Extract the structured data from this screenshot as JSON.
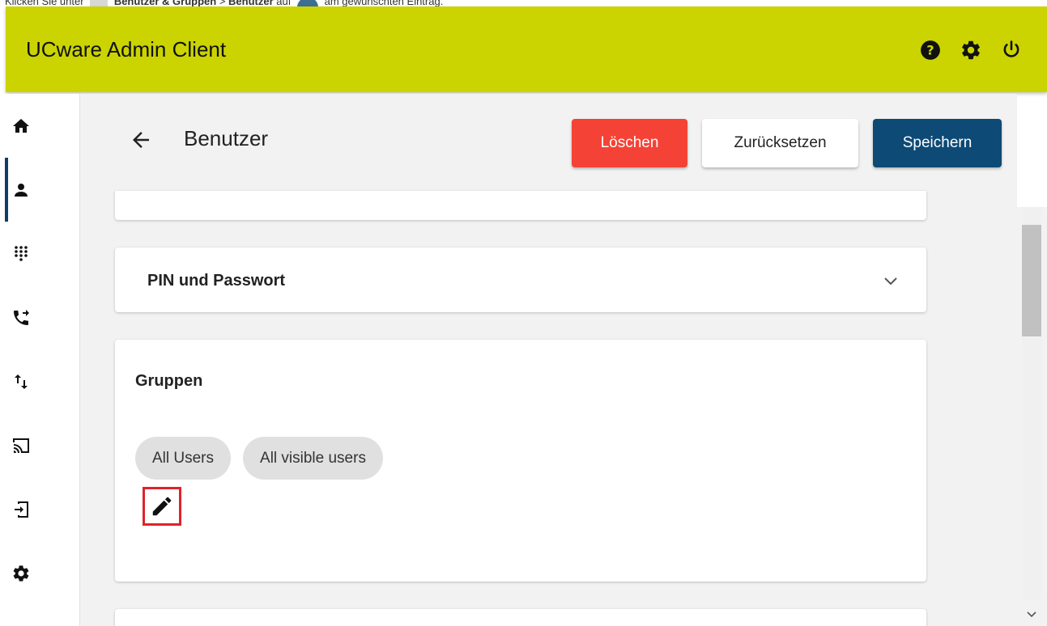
{
  "instruction": {
    "prefix": "Klicken Sie unter",
    "menu_path": "Benutzer & Gruppen",
    "separator": " > ",
    "submenu": "Benutzer",
    "middle": "auf",
    "suffix": "am gewünschten Eintrag."
  },
  "header": {
    "app_title": "UCware Admin Client",
    "icons": [
      "help-icon",
      "settings-icon",
      "power-icon"
    ]
  },
  "sidebar": {
    "items": [
      {
        "icon": "home-icon",
        "active": false
      },
      {
        "icon": "user-icon",
        "active": true
      },
      {
        "icon": "dialpad-icon",
        "active": false
      },
      {
        "icon": "call-forward-icon",
        "active": false
      },
      {
        "icon": "transfer-arrows-icon",
        "active": false
      },
      {
        "icon": "cast-icon",
        "active": false
      },
      {
        "icon": "login-icon",
        "active": false
      },
      {
        "icon": "settings-icon",
        "active": false
      }
    ]
  },
  "page": {
    "title": "Benutzer",
    "buttons": {
      "delete": "Löschen",
      "reset": "Zurücksetzen",
      "save": "Speichern"
    }
  },
  "sections": {
    "pin": {
      "label": "PIN und Passwort"
    },
    "groups": {
      "label": "Gruppen",
      "chips": [
        "All Users",
        "All visible users"
      ]
    }
  },
  "colors": {
    "topbar": "#cbd400",
    "delete": "#f44336",
    "save": "#0d4a76",
    "highlight": "#e0232a",
    "active_indicator": "#0d3f66"
  }
}
